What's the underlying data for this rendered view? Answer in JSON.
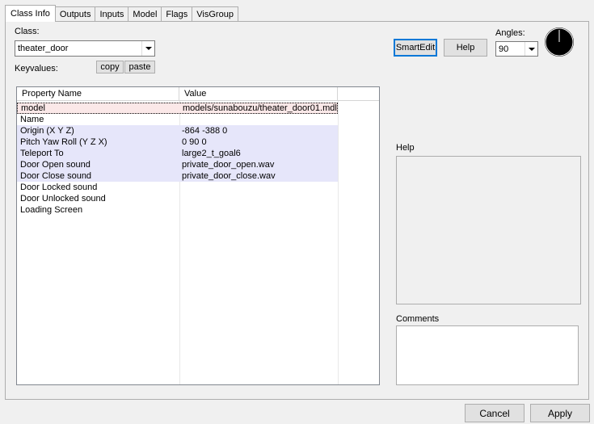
{
  "tabs": [
    "Class Info",
    "Outputs",
    "Inputs",
    "Model",
    "Flags",
    "VisGroup"
  ],
  "class_label": "Class:",
  "class_value": "theater_door",
  "keyvalues_label": "Keyvalues:",
  "copy_label": "copy",
  "paste_label": "paste",
  "smartedit_label": "SmartEdit",
  "help_button_label": "Help",
  "angles_label": "Angles:",
  "angles_value": "90",
  "columns": {
    "name": "Property Name",
    "value": "Value"
  },
  "rows": [
    {
      "key": "model",
      "value": "models/sunabouzu/theater_door01.mdl"
    },
    {
      "key": "Name",
      "value": ""
    },
    {
      "key": "Origin (X Y Z)",
      "value": "-864 -388 0"
    },
    {
      "key": "Pitch Yaw Roll (Y Z X)",
      "value": "0 90 0"
    },
    {
      "key": "Teleport To",
      "value": "large2_t_goal6"
    },
    {
      "key": "Door Open sound",
      "value": "private_door_open.wav"
    },
    {
      "key": "Door Close sound",
      "value": "private_door_close.wav"
    },
    {
      "key": "Door Locked sound",
      "value": ""
    },
    {
      "key": "Door Unlocked sound",
      "value": ""
    },
    {
      "key": "Loading Screen",
      "value": ""
    }
  ],
  "help_section_label": "Help",
  "comments_label": "Comments",
  "cancel_label": "Cancel",
  "apply_label": "Apply"
}
